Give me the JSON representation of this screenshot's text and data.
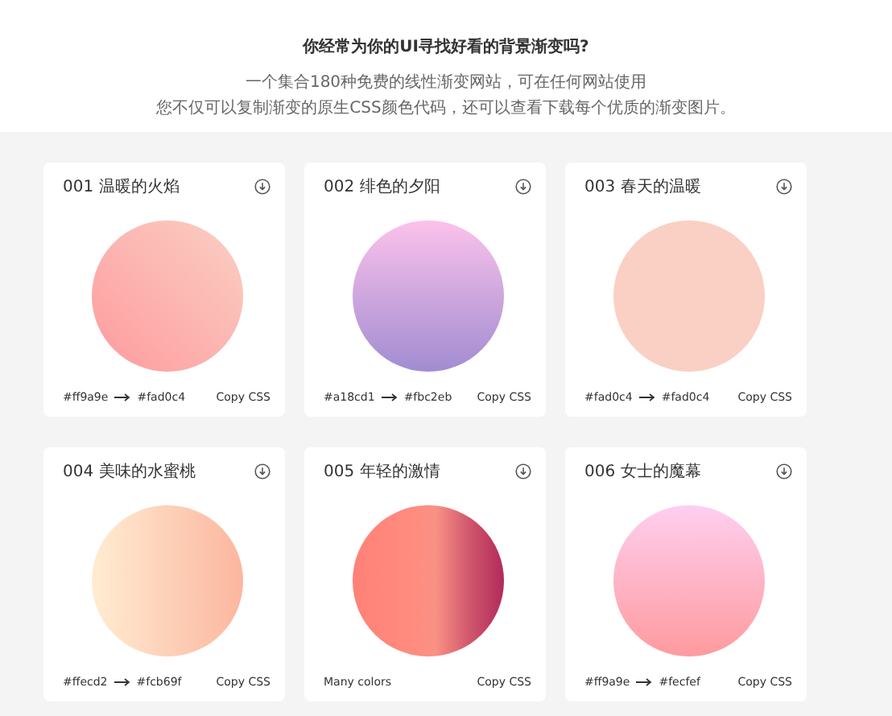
{
  "header": {
    "title": "你经常为你的UI寻找好看的背景渐变吗?",
    "lines": [
      "一个集合180种免费的线性渐变网站，可在任何网站使用",
      "您不仅可以复制渐变的原生CSS颜色代码，还可以查看下载每个优质的渐变图片。"
    ]
  },
  "cards": [
    {
      "title": "001 温暖的火焰",
      "kind": "diagonal",
      "from": "#ff9a9e",
      "to": "#fad0c4",
      "copy": "Copy CSS"
    },
    {
      "title": "002 绯色的夕阳",
      "kind": "vertical",
      "from": "#a18cd1",
      "to": "#fbc2eb",
      "copy": "Copy CSS"
    },
    {
      "title": "003 春天的温暖",
      "kind": "vertical",
      "from": "#fad0c4",
      "to": "#fad0c4",
      "copy": "Copy CSS"
    },
    {
      "title": "004 美味的水蜜桃",
      "kind": "horizontal",
      "from": "#ffecd2",
      "to": "#fcb69f",
      "copy": "Copy CSS"
    },
    {
      "title": "005 年轻的激情",
      "kind": "many",
      "label": "Many colors",
      "copy": "Copy CSS"
    },
    {
      "title": "006 女士的魔幕",
      "kind": "vertical",
      "from": "#ff9a9e",
      "to": "#fecfef",
      "copy": "Copy CSS"
    }
  ]
}
